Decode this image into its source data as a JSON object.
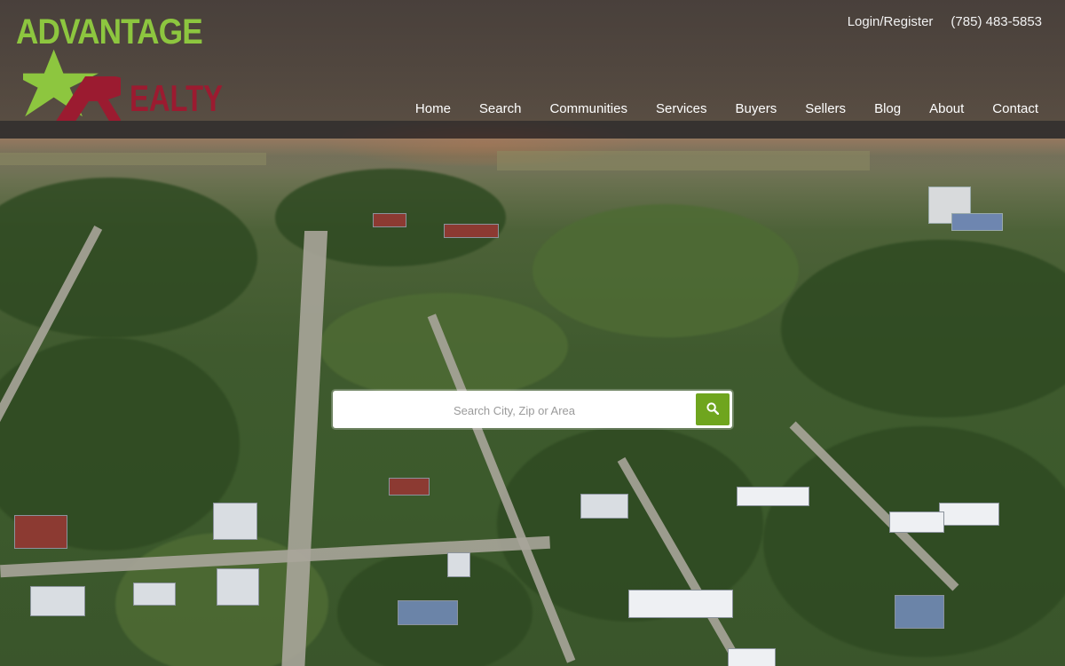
{
  "brand": {
    "line1": "ADVANTAGE",
    "line2": "REALTY",
    "colors": {
      "green": "#8dc63f",
      "maroon": "#9b1b30"
    }
  },
  "header": {
    "login_label": "Login/Register",
    "phone": "(785) 483-5853"
  },
  "nav": {
    "items": [
      {
        "label": "Home"
      },
      {
        "label": "Search"
      },
      {
        "label": "Communities"
      },
      {
        "label": "Services"
      },
      {
        "label": "Buyers"
      },
      {
        "label": "Sellers"
      },
      {
        "label": "Blog"
      },
      {
        "label": "About"
      },
      {
        "label": "Contact"
      }
    ]
  },
  "search": {
    "placeholder": "Search City, Zip or Area",
    "value": "",
    "button_icon": "search-icon",
    "button_color": "#6fa51e"
  },
  "hero": {
    "image_icon": "aerial-town-photo"
  }
}
